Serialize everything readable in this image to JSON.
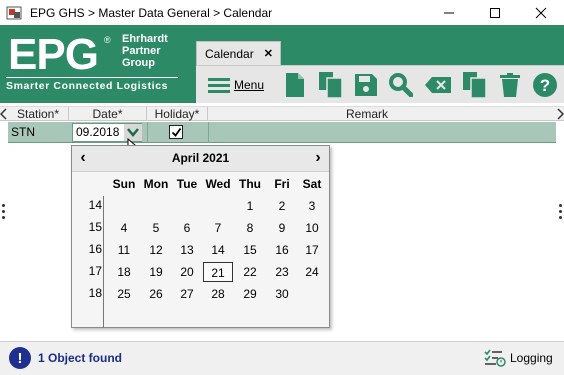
{
  "window": {
    "title": "EPG GHS > Master Data General > Calendar"
  },
  "logo": {
    "wordmark": "EPG",
    "registered": "®",
    "name_lines": [
      "Ehrhardt",
      "Partner",
      "Group"
    ],
    "tagline": "Smarter Connected Logistics"
  },
  "tab": {
    "label": "Calendar",
    "close": "✕"
  },
  "toolbar": {
    "menu_label": "Menu"
  },
  "grid": {
    "columns": [
      "Station*",
      "Date*",
      "Holiday*",
      "Remark"
    ],
    "row": {
      "station": "STN",
      "date": "09.2018",
      "holiday_checked": true
    }
  },
  "calendar": {
    "month_label": "April 2021",
    "prev": "‹",
    "next": "›",
    "weekdays": [
      "Sun",
      "Mon",
      "Tue",
      "Wed",
      "Thu",
      "Fri",
      "Sat"
    ],
    "weeks": [
      "14",
      "15",
      "16",
      "17",
      "18"
    ],
    "days": [
      [
        "",
        "",
        "",
        "",
        "1",
        "2",
        "3"
      ],
      [
        "4",
        "5",
        "6",
        "7",
        "8",
        "9",
        "10"
      ],
      [
        "11",
        "12",
        "13",
        "14",
        "15",
        "16",
        "17"
      ],
      [
        "18",
        "19",
        "20",
        "21",
        "22",
        "23",
        "24"
      ],
      [
        "25",
        "26",
        "27",
        "28",
        "29",
        "30",
        ""
      ]
    ],
    "today": "21"
  },
  "status": {
    "icon_text": "!",
    "message": "1 Object found",
    "logging_label": "Logging"
  },
  "colors": {
    "brand_green": "#2c8a67",
    "row_selected": "#a9c7b8",
    "status_blue": "#1a2d8a"
  }
}
